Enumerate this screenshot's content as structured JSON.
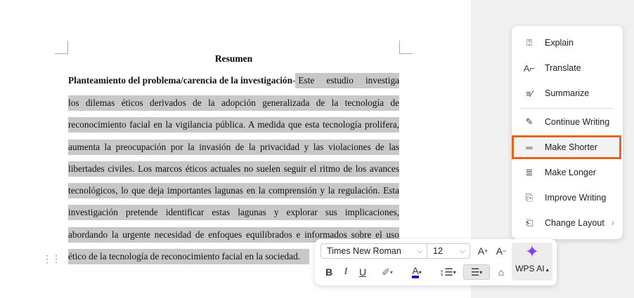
{
  "document": {
    "title": "Resumen",
    "heading_bold": "Planteamiento del problema/carencia de la investigación-",
    "first_line_rest": "Este estudio investiga",
    "lines": [
      "los dilemas éticos derivados de la adopción generalizada de la tecnología de",
      "reconocimiento facial en la vigilancia pública. A medida que esta tecnología prolifera,",
      "aumenta la preocupación por la invasión de la privacidad y las violaciones de las",
      "libertades civiles. Los marcos éticos actuales no suelen seguir el ritmo de los avances",
      "tecnológicos, lo que deja importantes lagunas en la comprensión y la regulación. Esta",
      "investigación pretende identificar estas lagunas y explorar sus implicaciones,",
      "abordando la urgente necesidad de enfoques equilibrados e informados sobre el uso"
    ],
    "last_line": "ético de la tecnología de reconocimiento facial en la sociedad."
  },
  "ai_menu": {
    "items": [
      {
        "label": "Explain",
        "icon": "explain-icon"
      },
      {
        "label": "Translate",
        "icon": "translate-icon"
      },
      {
        "label": "Summarize",
        "icon": "summarize-icon"
      },
      {
        "label": "Continue Writing",
        "icon": "pen-icon"
      },
      {
        "label": "Make Shorter",
        "icon": "make-shorter-icon"
      },
      {
        "label": "Make Longer",
        "icon": "make-longer-icon"
      },
      {
        "label": "Improve Writing",
        "icon": "improve-icon"
      },
      {
        "label": "Change Layout",
        "icon": "layout-icon"
      }
    ],
    "highlight_color": "#e8641b"
  },
  "toolbar": {
    "font": "Times New Roman",
    "size": "12",
    "wps_ai": "WPS AI",
    "font_color": "#1a1acc"
  }
}
